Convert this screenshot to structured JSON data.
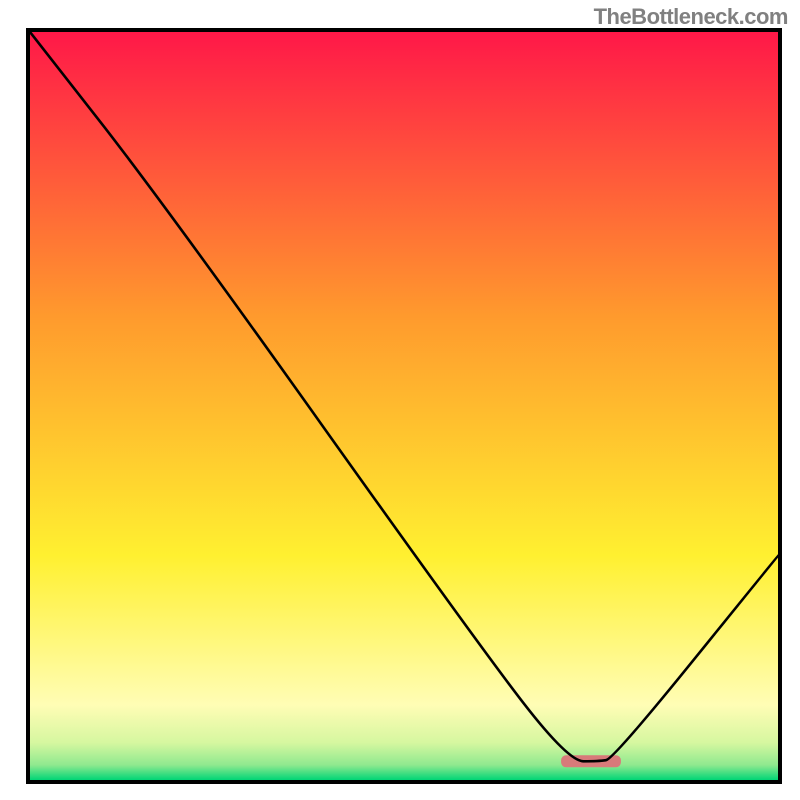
{
  "attribution": "TheBottleneck.com",
  "chart_data": {
    "type": "line",
    "title": "",
    "xlabel": "",
    "ylabel": "",
    "xlim": [
      0,
      100
    ],
    "ylim": [
      0,
      100
    ],
    "series": [
      {
        "name": "curve",
        "x": [
          0,
          18,
          60,
          72,
          76,
          78,
          100
        ],
        "values": [
          100,
          77,
          18,
          2.5,
          2.5,
          2.8,
          30
        ]
      }
    ],
    "marker": {
      "name": "highlight-bar",
      "x_start": 71,
      "x_end": 79,
      "y": 2.5,
      "color": "#d87a7a"
    },
    "gradient_bands": [
      {
        "y": 100,
        "color": "#ff1848"
      },
      {
        "y": 62,
        "color": "#ff9a2d"
      },
      {
        "y": 30,
        "color": "#fff030"
      },
      {
        "y": 10,
        "color": "#fffdb5"
      },
      {
        "y": 5,
        "color": "#d6f7a0"
      },
      {
        "y": 2,
        "color": "#8fe98f"
      },
      {
        "y": 0,
        "color": "#00d576"
      }
    ]
  }
}
